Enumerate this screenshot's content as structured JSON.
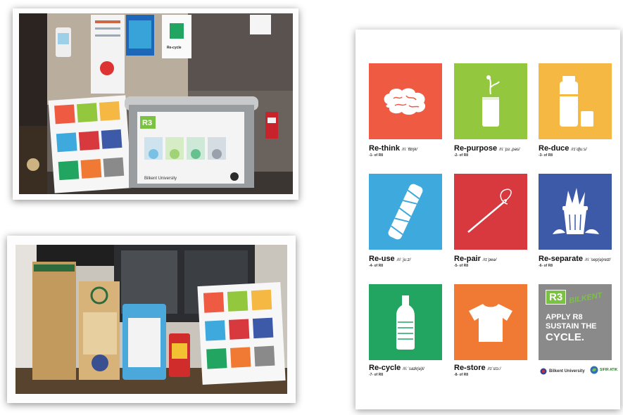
{
  "poster": {
    "tiles": [
      {
        "title": "Re-think",
        "phonetic": "/riːˈθɪŋk/",
        "sub": "-1- of R8",
        "color": "#ef5a43",
        "icon": "brain-icon"
      },
      {
        "title": "Re-purpose",
        "phonetic": "/riːˈpɜː.pəs/",
        "sub": "-2- of R8",
        "color": "#93c83e",
        "icon": "can-icon"
      },
      {
        "title": "Re-duce",
        "phonetic": "/rɪˈdjuːs/",
        "sub": "-3- of R8",
        "color": "#f5b843",
        "icon": "thermos-icon"
      },
      {
        "title": "Re-use",
        "phonetic": "/riːˈjuːz/",
        "sub": "-4- of R8",
        "color": "#3ea9dc",
        "icon": "rolled-paper-icon"
      },
      {
        "title": "Re-pair",
        "phonetic": "/rɪˈpeə/",
        "sub": "-5- of R8",
        "color": "#d8393e",
        "icon": "needle-icon"
      },
      {
        "title": "Re-separate",
        "phonetic": "/riːˈsep(ə)reɪt/",
        "sub": "-6- of R8",
        "color": "#3d5aa8",
        "icon": "trash-bin-icon"
      },
      {
        "title": "Re-cycle",
        "phonetic": "/riːˈsaɪk(ə)l/",
        "sub": "-7- of R8",
        "color": "#22a561",
        "icon": "bottle-icon"
      },
      {
        "title": "Re-store",
        "phonetic": "/rɪˈstɔː/",
        "sub": "-8- of R8",
        "color": "#f07a33",
        "icon": "tshirt-icon"
      }
    ],
    "brand": {
      "logo": "R3",
      "bilkent": "BILKENT",
      "line1": "APPLY R8",
      "line2": "SUSTAIN THE",
      "line3": "CYCLE."
    },
    "footer_left": "Bilkent University",
    "footer_right": "SIFIR ATIK"
  },
  "photo1": {
    "sign_title": "Re-cycle",
    "board_logo": "R3",
    "board_footer": "Bilkent University"
  }
}
